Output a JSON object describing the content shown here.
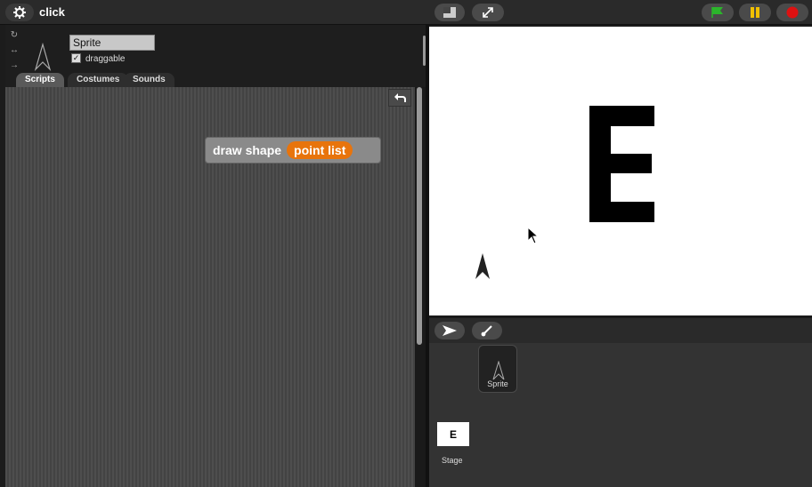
{
  "project": {
    "title": "click"
  },
  "sprite": {
    "name": "Sprite",
    "draggable_label": "draggable",
    "draggable_checked": "✓"
  },
  "tabs": [
    {
      "label": "Scripts"
    },
    {
      "label": "Costumes"
    },
    {
      "label": "Sounds"
    }
  ],
  "script_block": {
    "label": "draw shape",
    "slot": "point list"
  },
  "corral": {
    "sprites": [
      {
        "name": "Sprite"
      }
    ],
    "stage": {
      "name": "Stage",
      "thumb_text": "E"
    }
  },
  "stage": {
    "letter": "E"
  },
  "colors": {
    "green_flag": "#2bb52b",
    "pause": "#f0c000",
    "stop": "#dd1111",
    "block_slot": "#e8740c"
  },
  "icons": [
    "gear-icon",
    "stage-size-icon",
    "fullscreen-icon",
    "green-flag-icon",
    "pause-icon",
    "stop-icon",
    "undo-icon",
    "turtle-icon",
    "paintbrush-icon",
    "cursor-icon"
  ]
}
